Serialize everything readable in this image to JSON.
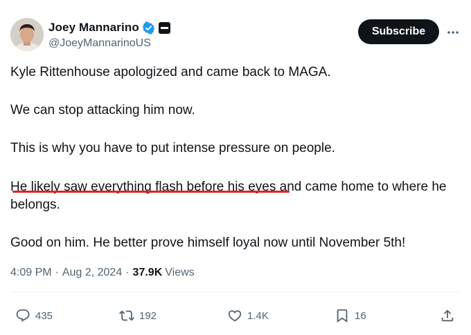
{
  "author": {
    "display_name": "Joey Mannarino",
    "handle": "@JoeyMannarinoUS"
  },
  "header": {
    "subscribe_label": "Subscribe"
  },
  "tweet": {
    "paragraphs": [
      "Kyle Rittenhouse apologized and came back to MAGA.",
      "We can stop attacking him now.",
      "This is why you have to put intense pressure on people.",
      "He likely saw everything flash before his eyes and came home to where he belongs.",
      "Good on him. He better prove himself loyal now until November 5th!"
    ],
    "highlighted": "He likely saw everything flash before his eyes",
    "rest_of_p4": " and came home to where he belongs.",
    "highlight_color": "#e0241b"
  },
  "meta": {
    "time": "4:09 PM",
    "separator": "·",
    "date": "Aug 2, 2024",
    "views_count": "37.9K",
    "views_label": "Views"
  },
  "actions": {
    "replies": "435",
    "reposts": "192",
    "likes": "1.4K",
    "bookmarks": "16"
  },
  "icons": [
    "verified-badge-icon",
    "affiliation-badge-icon",
    "more-icon",
    "reply-icon",
    "repost-icon",
    "like-icon",
    "bookmark-icon",
    "share-icon"
  ],
  "colors": {
    "text": "#0f1419",
    "secondary": "#536471",
    "verified_blue": "#1d9bf0",
    "button_bg": "#0f1419"
  }
}
